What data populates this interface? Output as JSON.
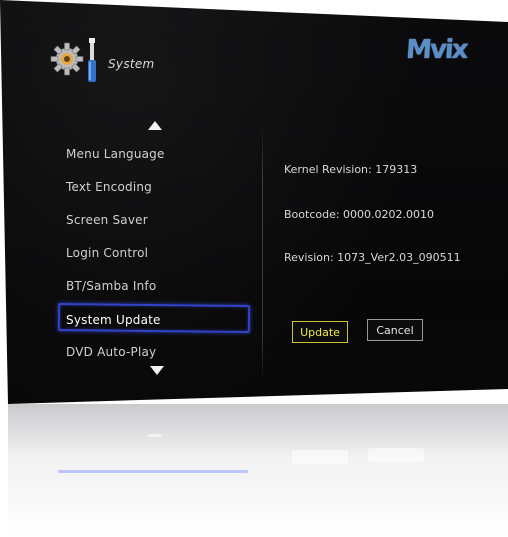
{
  "header": {
    "title": "System",
    "icons": [
      "gear-icon",
      "wrench-icon"
    ]
  },
  "brand": {
    "logo_text": "Mvix"
  },
  "menu": {
    "items": [
      {
        "label": "Menu Language"
      },
      {
        "label": "Text Encoding"
      },
      {
        "label": "Screen Saver"
      },
      {
        "label": "Login Control"
      },
      {
        "label": "BT/Samba Info"
      },
      {
        "label": "System Update",
        "selected": true
      },
      {
        "label": "DVD Auto-Play"
      }
    ],
    "scroll_up_icon": "triangle-up-icon",
    "scroll_down_icon": "triangle-down-icon"
  },
  "info": {
    "kernel": "Kernel Revision: 179313",
    "bootcode": "Bootcode: 0000.0202.0010",
    "revision": "Revision: 1073_Ver2.03_090511"
  },
  "buttons": {
    "update": "Update",
    "cancel": "Cancel"
  },
  "colors": {
    "screen_bg": "#080809",
    "selection_border": "#2f3fc8",
    "update_highlight": "#f0ea4a",
    "brand_blue": "#5a8ec8"
  }
}
